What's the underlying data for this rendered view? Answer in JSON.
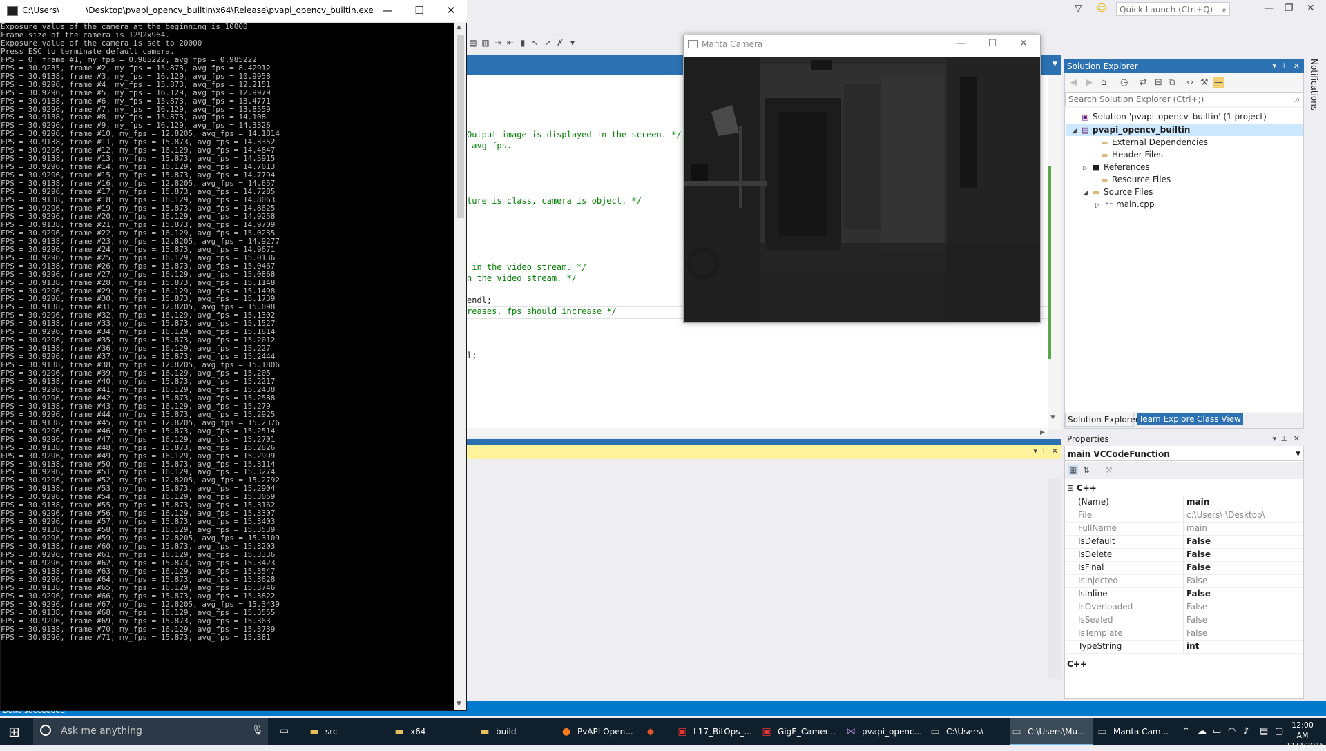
{
  "console": {
    "title": "C:\\Users\\          \\Desktop\\pvapi_opencv_builtin\\x64\\Release\\pvapi_opencv_builtin.exe",
    "lines": [
      "Exposure value of the camera at the beginning is 10000",
      "Frame size of the camera is 1292x964.",
      "Exposure value of the camera is set to 20000",
      "Press ESC to terminate default camera.",
      "FPS = 0, frame #1, my_fps = 0.985222, avg_fps = 0.985222",
      "FPS = 30.9235, frame #2, my_fps = 15.873, avg_fps = 8.42912",
      "FPS = 30.9138, frame #3, my_fps = 16.129, avg_fps = 10.9958",
      "FPS = 30.9296, frame #4, my_fps = 15.873, avg_fps = 12.2151",
      "FPS = 30.9296, frame #5, my_fps = 16.129, avg_fps = 12.9979",
      "FPS = 30.9138, frame #6, my_fps = 15.873, avg_fps = 13.4771",
      "FPS = 30.9296, frame #7, my_fps = 16.129, avg_fps = 13.8559",
      "FPS = 30.9138, frame #8, my_fps = 15.873, avg_fps = 14.108",
      "FPS = 30.9296, frame #9, my_fps = 16.129, avg_fps = 14.3326",
      "FPS = 30.9296, frame #10, my_fps = 12.8205, avg_fps = 14.1814",
      "FPS = 30.9138, frame #11, my_fps = 15.873, avg_fps = 14.3352",
      "FPS = 30.9296, frame #12, my_fps = 16.129, avg_fps = 14.4847",
      "FPS = 30.9138, frame #13, my_fps = 15.873, avg_fps = 14.5915",
      "FPS = 30.9296, frame #14, my_fps = 16.129, avg_fps = 14.7013",
      "FPS = 30.9296, frame #15, my_fps = 15.873, avg_fps = 14.7794",
      "FPS = 30.9138, frame #16, my_fps = 12.8205, avg_fps = 14.657",
      "FPS = 30.9296, frame #17, my_fps = 15.873, avg_fps = 14.7285",
      "FPS = 30.9138, frame #18, my_fps = 16.129, avg_fps = 14.8063",
      "FPS = 30.9296, frame #19, my_fps = 15.873, avg_fps = 14.8625",
      "FPS = 30.9296, frame #20, my_fps = 16.129, avg_fps = 14.9258",
      "FPS = 30.9138, frame #21, my_fps = 15.873, avg_fps = 14.9709",
      "FPS = 30.9296, frame #22, my_fps = 16.129, avg_fps = 15.0235",
      "FPS = 30.9138, frame #23, my_fps = 12.8205, avg_fps = 14.9277",
      "FPS = 30.9296, frame #24, my_fps = 15.873, avg_fps = 14.9671",
      "FPS = 30.9296, frame #25, my_fps = 16.129, avg_fps = 15.0136",
      "FPS = 30.9138, frame #26, my_fps = 15.873, avg_fps = 15.0467",
      "FPS = 30.9296, frame #27, my_fps = 16.129, avg_fps = 15.0868",
      "FPS = 30.9138, frame #28, my_fps = 15.873, avg_fps = 15.1148",
      "FPS = 30.9296, frame #29, my_fps = 16.129, avg_fps = 15.1498",
      "FPS = 30.9296, frame #30, my_fps = 15.873, avg_fps = 15.1739",
      "FPS = 30.9138, frame #31, my_fps = 12.8205, avg_fps = 15.098",
      "FPS = 30.9296, frame #32, my_fps = 16.129, avg_fps = 15.1302",
      "FPS = 30.9138, frame #33, my_fps = 15.873, avg_fps = 15.1527",
      "FPS = 30.9296, frame #34, my_fps = 16.129, avg_fps = 15.1814",
      "FPS = 30.9296, frame #35, my_fps = 15.873, avg_fps = 15.2012",
      "FPS = 30.9138, frame #36, my_fps = 16.129, avg_fps = 15.227",
      "FPS = 30.9296, frame #37, my_fps = 15.873, avg_fps = 15.2444",
      "FPS = 30.9138, frame #38, my_fps = 12.8205, avg_fps = 15.1806",
      "FPS = 30.9296, frame #39, my_fps = 16.129, avg_fps = 15.205",
      "FPS = 30.9138, frame #40, my_fps = 15.873, avg_fps = 15.2217",
      "FPS = 30.9296, frame #41, my_fps = 16.129, avg_fps = 15.2438",
      "FPS = 30.9296, frame #42, my_fps = 15.873, avg_fps = 15.2588",
      "FPS = 30.9138, frame #43, my_fps = 16.129, avg_fps = 15.279",
      "FPS = 30.9296, frame #44, my_fps = 15.873, avg_fps = 15.2925",
      "FPS = 30.9138, frame #45, my_fps = 12.8205, avg_fps = 15.2376",
      "FPS = 30.9296, frame #46, my_fps = 15.873, avg_fps = 15.2514",
      "FPS = 30.9296, frame #47, my_fps = 16.129, avg_fps = 15.2701",
      "FPS = 30.9138, frame #48, my_fps = 15.873, avg_fps = 15.2826",
      "FPS = 30.9296, frame #49, my_fps = 16.129, avg_fps = 15.2999",
      "FPS = 30.9138, frame #50, my_fps = 15.873, avg_fps = 15.3114",
      "FPS = 30.9296, frame #51, my_fps = 16.129, avg_fps = 15.3274",
      "FPS = 30.9296, frame #52, my_fps = 12.8205, avg_fps = 15.2792",
      "FPS = 30.9138, frame #53, my_fps = 15.873, avg_fps = 15.2904",
      "FPS = 30.9296, frame #54, my_fps = 16.129, avg_fps = 15.3059",
      "FPS = 30.9138, frame #55, my_fps = 15.873, avg_fps = 15.3162",
      "FPS = 30.9296, frame #56, my_fps = 16.129, avg_fps = 15.3307",
      "FPS = 30.9296, frame #57, my_fps = 15.873, avg_fps = 15.3403",
      "FPS = 30.9138, frame #58, my_fps = 16.129, avg_fps = 15.3539",
      "FPS = 30.9296, frame #59, my_fps = 12.8205, avg_fps = 15.3109",
      "FPS = 30.9138, frame #60, my_fps = 15.873, avg_fps = 15.3203",
      "FPS = 30.9296, frame #61, my_fps = 16.129, avg_fps = 15.3336",
      "FPS = 30.9296, frame #62, my_fps = 15.873, avg_fps = 15.3423",
      "FPS = 30.9138, frame #63, my_fps = 16.129, avg_fps = 15.3547",
      "FPS = 30.9296, frame #64, my_fps = 15.873, avg_fps = 15.3628",
      "FPS = 30.9138, frame #65, my_fps = 16.129, avg_fps = 15.3746",
      "FPS = 30.9296, frame #66, my_fps = 15.873, avg_fps = 15.3822",
      "FPS = 30.9296, frame #67, my_fps = 12.8205, avg_fps = 15.3439",
      "FPS = 30.9138, frame #68, my_fps = 16.129, avg_fps = 15.3555",
      "FPS = 30.9296, frame #69, my_fps = 15.873, avg_fps = 15.363",
      "FPS = 30.9138, frame #70, my_fps = 16.129, avg_fps = 15.3739",
      "FPS = 30.9296, frame #71, my_fps = 15.873, avg_fps = 15.381"
    ],
    "controls": {
      "minimize": "—",
      "maximize": "☐",
      "close": "✕"
    }
  },
  "camera_window": {
    "title": "Manta Camera",
    "controls": {
      "minimize": "—",
      "maximize": "☐",
      "close": "✕"
    }
  },
  "editor": {
    "lines": [
      {
        "text": "Output image is displayed in the screen. */",
        "comment": true
      },
      {
        "text": " avg_fps.",
        "comment": true
      },
      {
        "text": "ture is class, camera is object. */",
        "comment": true
      },
      {
        "text": " in the video stream. */",
        "comment": true
      },
      {
        "text": "n the video stream. */",
        "comment": true
      },
      {
        "text": "endl;",
        "comment": false
      },
      {
        "text": "reases, fps should increase */",
        "comment": true
      },
      {
        "text": "l;",
        "comment": false
      }
    ]
  },
  "quick_launch": {
    "placeholder": "Quick Launch (Ctrl+Q)",
    "icon": "search-icon"
  },
  "notifications_label": "Notifications",
  "solution_explorer": {
    "title": "Solution Explorer",
    "search_placeholder": "Search Solution Explorer (Ctrl+;)",
    "tree": [
      {
        "label": "Solution 'pvapi_opencv_builtin' (1 project)",
        "icon": "solution-icon",
        "expander": ""
      },
      {
        "label": "pvapi_opencv_builtin",
        "icon": "project-icon",
        "expander": "◢",
        "bold": true,
        "selected": true
      },
      {
        "label": "External Dependencies",
        "icon": "folder-icon",
        "expander": ""
      },
      {
        "label": "Header Files",
        "icon": "folder-icon",
        "expander": ""
      },
      {
        "label": "References",
        "icon": "references-icon",
        "expander": "▷"
      },
      {
        "label": "Resource Files",
        "icon": "folder-icon",
        "expander": ""
      },
      {
        "label": "Source Files",
        "icon": "folder-icon",
        "expander": "◢"
      },
      {
        "label": "main.cpp",
        "icon": "cpp-file-icon",
        "expander": "▷"
      }
    ],
    "tabs": [
      "Solution Explorer",
      "Team Explorer",
      "Class View"
    ]
  },
  "properties": {
    "title": "Properties",
    "object": "main  VCCodeFunction",
    "category": "C++",
    "rows": [
      {
        "name": "(Name)",
        "value": "main",
        "bold": true,
        "dim": false
      },
      {
        "name": "File",
        "value": "c:\\Users\\          \\Desktop\\",
        "bold": false,
        "dim": true
      },
      {
        "name": "FullName",
        "value": "main",
        "bold": false,
        "dim": true
      },
      {
        "name": "IsDefault",
        "value": "False",
        "bold": true,
        "dim": false
      },
      {
        "name": "IsDelete",
        "value": "False",
        "bold": true,
        "dim": false
      },
      {
        "name": "IsFinal",
        "value": "False",
        "bold": true,
        "dim": false
      },
      {
        "name": "IsInjected",
        "value": "False",
        "bold": false,
        "dim": true
      },
      {
        "name": "IsInline",
        "value": "False",
        "bold": true,
        "dim": false
      },
      {
        "name": "IsOverloaded",
        "value": "False",
        "bold": false,
        "dim": true
      },
      {
        "name": "IsSealed",
        "value": "False",
        "bold": false,
        "dim": true
      },
      {
        "name": "IsTemplate",
        "value": "False",
        "bold": false,
        "dim": true
      },
      {
        "name": "TypeString",
        "value": "int",
        "bold": true,
        "dim": false
      }
    ],
    "description": "C++"
  },
  "status_bar": {
    "text": "Build succeeded"
  },
  "taskbar": {
    "search_placeholder": "Ask me anything",
    "items": [
      {
        "label": "src",
        "icon": "folder-icon",
        "active": false
      },
      {
        "label": "x64",
        "icon": "folder-icon",
        "active": false
      },
      {
        "label": "build",
        "icon": "folder-icon",
        "active": false
      },
      {
        "label": "PvAPI Open...",
        "icon": "firefox-icon",
        "active": false
      },
      {
        "label": "",
        "icon": "app-icon",
        "active": false
      },
      {
        "label": "L17_BitOps_...",
        "icon": "pdf-icon",
        "active": false
      },
      {
        "label": "GigE_Camer...",
        "icon": "pdf-icon",
        "active": false
      },
      {
        "label": "pvapi_openc...",
        "icon": "visual-studio-icon",
        "active": false
      },
      {
        "label": "C:\\Users\\",
        "icon": "console-icon",
        "active": false
      },
      {
        "label": "C:\\Users\\Mu...",
        "icon": "console-icon",
        "active": true
      },
      {
        "label": "Manta Cam...",
        "icon": "window-icon",
        "active": false
      }
    ],
    "clock": {
      "time": "12:00 AM",
      "date": "11/3/2015"
    }
  }
}
